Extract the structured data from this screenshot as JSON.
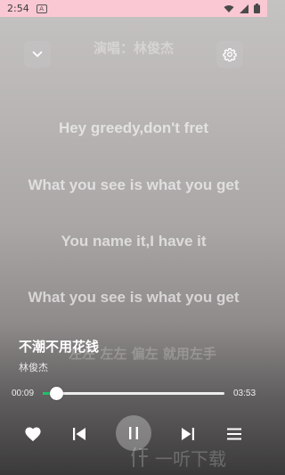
{
  "status_bar": {
    "time": "2:54",
    "notification_badge": "A"
  },
  "header": {
    "singer_label": "演唱：林俊杰"
  },
  "lyrics": [
    "Hey greedy,don't fret",
    "What you see is what you get",
    "You name it,I have it",
    "What you see is what you get",
    "左左 左左 偏左 就用左手"
  ],
  "song": {
    "title": "不潮不用花钱",
    "artist": "林俊杰"
  },
  "progress": {
    "current": "00:09",
    "total": "03:53",
    "fraction": 0.075
  },
  "controls": {
    "like_icon": "heart-icon",
    "prev_icon": "skip-previous-icon",
    "play_state": "playing",
    "pause_icon": "pause-icon",
    "next_icon": "skip-next-icon",
    "playlist_icon": "menu-icon"
  },
  "watermark": {
    "text": "一听下载"
  },
  "colors": {
    "status_bar_bg": "#f9c8d3",
    "progress_accent": "#1fbf6b"
  }
}
